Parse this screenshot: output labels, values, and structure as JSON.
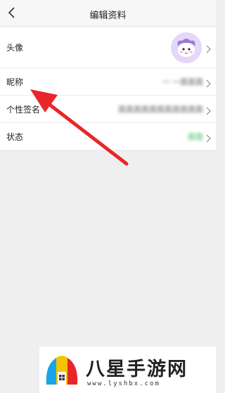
{
  "header": {
    "title": "编辑资料"
  },
  "rows": {
    "avatar": {
      "label": "头像"
    },
    "nickname": {
      "label": "昵称",
      "value": "一 一面面面"
    },
    "signature": {
      "label": "个性签名",
      "value": "面面面面面面面面面面面"
    },
    "status": {
      "label": "状态",
      "value": "面面"
    }
  },
  "watermark": {
    "text": "八星手游网",
    "url": "www.lyshbx.com"
  },
  "colors": {
    "arrow": "#e8262a",
    "status_value": "#3bbf5c"
  }
}
